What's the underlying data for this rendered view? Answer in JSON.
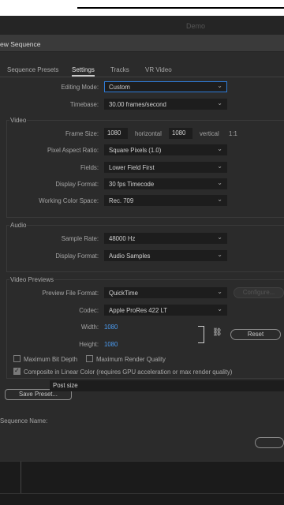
{
  "app": {
    "title": "Demo"
  },
  "dialog": {
    "title": "ew Sequence"
  },
  "tabs": [
    {
      "label": "Sequence Presets"
    },
    {
      "label": "Settings"
    },
    {
      "label": "Tracks"
    },
    {
      "label": "VR Video"
    }
  ],
  "settings": {
    "editing_mode": {
      "label": "Editing Mode:",
      "value": "Custom"
    },
    "timebase": {
      "label": "Timebase:",
      "value": "30.00  frames/second"
    }
  },
  "video": {
    "group_label": "Video",
    "frame_size": {
      "label": "Frame Size:",
      "width": "1080",
      "horizontal": "horizontal",
      "height": "1080",
      "vertical": "vertical",
      "ratio": "1:1"
    },
    "pixel_aspect": {
      "label": "Pixel Aspect Ratio:",
      "value": "Square Pixels (1.0)"
    },
    "fields": {
      "label": "Fields:",
      "value": "Lower Field First"
    },
    "display_format": {
      "label": "Display Format:",
      "value": "30 fps Timecode"
    },
    "color_space": {
      "label": "Working Color Space:",
      "value": "Rec. 709"
    }
  },
  "audio": {
    "group_label": "Audio",
    "sample_rate": {
      "label": "Sample Rate:",
      "value": "48000 Hz"
    },
    "display_format": {
      "label": "Display Format:",
      "value": "Audio Samples"
    }
  },
  "previews": {
    "group_label": "Video Previews",
    "file_format": {
      "label": "Preview File Format:",
      "value": "QuickTime",
      "configure": "Configure..."
    },
    "codec": {
      "label": "Codec:",
      "value": "Apple ProRes 422 LT"
    },
    "width": {
      "label": "Width:",
      "value": "1080"
    },
    "height": {
      "label": "Height:",
      "value": "1080"
    },
    "reset": "Reset"
  },
  "options": {
    "max_bit_depth": "Maximum Bit Depth",
    "max_render_quality": "Maximum Render Quality",
    "linear_color": "Composite in Linear Color (requires GPU acceleration or max render quality)"
  },
  "save_preset": "Save Preset...",
  "sequence_name": {
    "label": "Sequence Name:",
    "value": "Post size"
  }
}
